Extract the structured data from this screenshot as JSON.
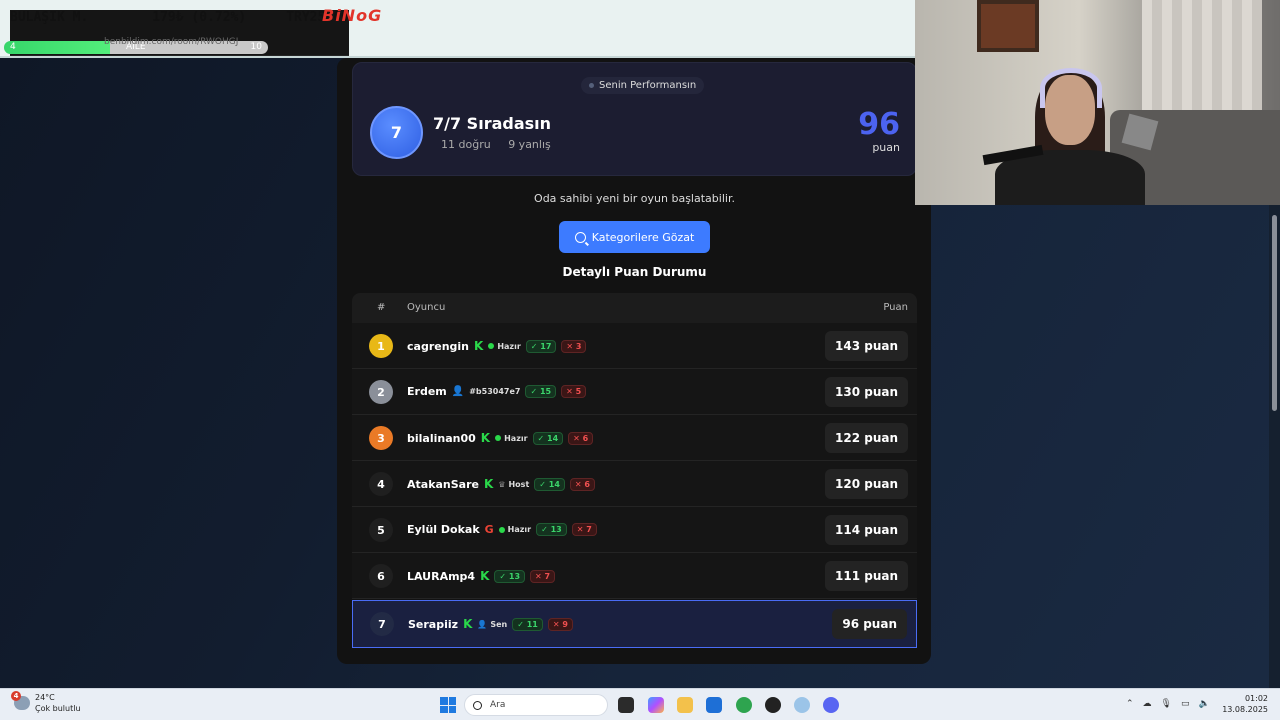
{
  "ticker": {
    "item1": "BULAŞIK M.",
    "item2": "179₺ (0.72%)",
    "item3": "TRY25000",
    "logo": "BiNoG",
    "bar_left": "4",
    "bar_center": "AİLE",
    "bar_right": "10",
    "bar_progress": 0.4,
    "url": "benbildim.com/room/RWOHGJ"
  },
  "performance": {
    "tag": "Senin Performansın",
    "position": "7",
    "rank_text": "7/7 Sıradasın",
    "correct": "11 doğru",
    "wrong": "9 yanlış",
    "score": "96",
    "score_label": "puan",
    "score_color": "#4c63f0"
  },
  "notice": "Oda sahibi yeni bir oyun başlatabilir.",
  "browse_button": "Kategorilere Gözat",
  "scoreboard_title": "Detaylı Puan Durumu",
  "table": {
    "headers": {
      "rank": "#",
      "player": "Oyuncu",
      "score": "Puan"
    },
    "rows": [
      {
        "rank": "1",
        "name": "cagrengin",
        "icon": "k-icon",
        "badge": "Hazır",
        "ok": "17",
        "bad": "3",
        "score": "143 puan"
      },
      {
        "rank": "2",
        "name": "Erdem",
        "icon": "person-icon",
        "badge": "#b53047e7",
        "ok": "15",
        "bad": "5",
        "score": "130 puan"
      },
      {
        "rank": "3",
        "name": "bilalinan00",
        "icon": "k-icon",
        "badge": "Hazır",
        "ok": "14",
        "bad": "6",
        "score": "122 puan"
      },
      {
        "rank": "4",
        "name": "AtakanSare",
        "icon": "k-icon",
        "badge": "Host",
        "ok": "14",
        "bad": "6",
        "score": "120 puan"
      },
      {
        "rank": "5",
        "name": "Eylül Dokak",
        "icon": "google-icon",
        "badge": "Hazır",
        "ok": "13",
        "bad": "7",
        "score": "114 puan"
      },
      {
        "rank": "6",
        "name": "LAURAmp4",
        "icon": "k-icon",
        "badge": "",
        "ok": "13",
        "bad": "7",
        "score": "111 puan"
      },
      {
        "rank": "7",
        "name": "Serapiiz",
        "icon": "k-icon",
        "badge": "Sen",
        "ok": "11",
        "bad": "9",
        "score": "96 puan"
      }
    ]
  },
  "rank_colors": {
    "gold": "#e8b817",
    "silver": "#8a8f99",
    "bronze": "#ea7a26"
  },
  "taskbar": {
    "temp": "24°C",
    "weather": "Çok bulutlu",
    "notif_count": "4",
    "search_placeholder": "Ara",
    "time": "01:02",
    "date": "13.08.2025"
  }
}
